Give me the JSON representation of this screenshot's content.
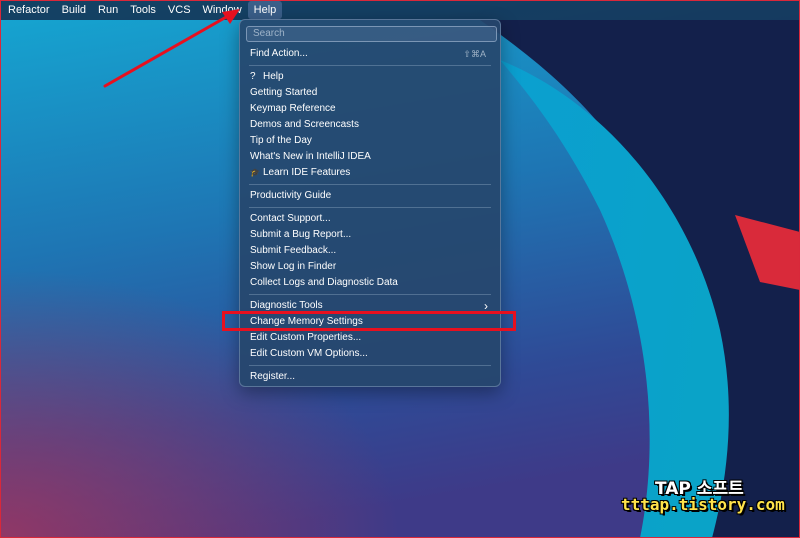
{
  "menubar": {
    "items": [
      "Refactor",
      "Build",
      "Run",
      "Tools",
      "VCS",
      "Window",
      "Help"
    ],
    "active": "Help"
  },
  "help_menu": {
    "search_placeholder": "Search",
    "find_action": {
      "label": "Find Action...",
      "shortcut": "⇧⌘A"
    },
    "group1": [
      {
        "label": "Help",
        "icon": "question-icon",
        "glyph": "?"
      },
      {
        "label": "Getting Started"
      },
      {
        "label": "Keymap Reference"
      },
      {
        "label": "Demos and Screencasts"
      },
      {
        "label": "Tip of the Day"
      },
      {
        "label": "What's New in IntelliJ IDEA"
      },
      {
        "label": "Learn IDE Features",
        "icon": "graduation-cap-icon",
        "glyph": "🎓"
      }
    ],
    "group2": [
      {
        "label": "Productivity Guide"
      }
    ],
    "group3": [
      {
        "label": "Contact Support..."
      },
      {
        "label": "Submit a Bug Report..."
      },
      {
        "label": "Submit Feedback..."
      },
      {
        "label": "Show Log in Finder"
      },
      {
        "label": "Collect Logs and Diagnostic Data"
      }
    ],
    "group4": [
      {
        "label": "Diagnostic Tools",
        "submenu_glyph": "›"
      },
      {
        "label": "Change Memory Settings"
      },
      {
        "label": "Edit Custom Properties..."
      },
      {
        "label": "Edit Custom VM Options..."
      }
    ],
    "group5": [
      {
        "label": "Register..."
      }
    ]
  },
  "annotations": {
    "highlight_color": "#e8101f",
    "highlighted_item": "Change Memory Settings",
    "arrow_color": "#e8101f"
  },
  "watermark": {
    "title": "TAP 소프트",
    "url": "tttap.tistory.com"
  },
  "colors": {
    "wallpaper_cyan": "#1aa6cf",
    "wallpaper_navy": "#14204a",
    "wallpaper_red": "#d92a3a",
    "menu_bg": "#26466c"
  }
}
